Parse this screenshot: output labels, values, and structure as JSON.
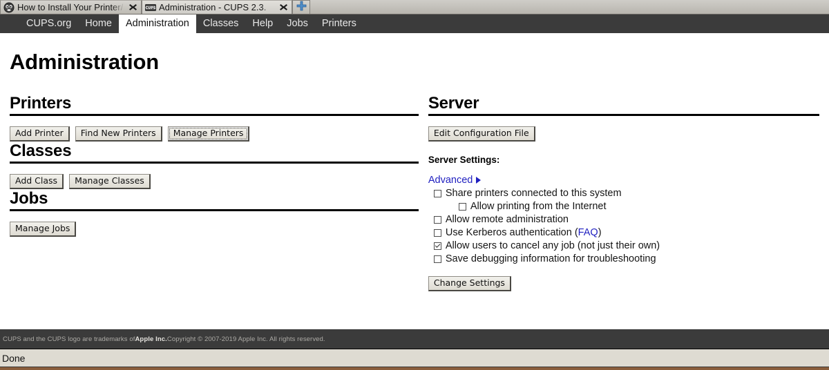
{
  "browser": {
    "tabs": [
      {
        "title": "How to Install Your Printer/",
        "favicon": "printer-tab-icon",
        "active": false,
        "close_label": "✖"
      },
      {
        "title": "Administration - CUPS 2.3.",
        "favicon": "cups-favicon",
        "active": true,
        "close_label": "✖"
      }
    ],
    "new_tab_label": "+"
  },
  "navbar": {
    "items": [
      {
        "label": "CUPS.org",
        "current": false
      },
      {
        "label": "Home",
        "current": false
      },
      {
        "label": "Administration",
        "current": true
      },
      {
        "label": "Classes",
        "current": false
      },
      {
        "label": "Help",
        "current": false
      },
      {
        "label": "Jobs",
        "current": false
      },
      {
        "label": "Printers",
        "current": false
      }
    ]
  },
  "page": {
    "title": "Administration"
  },
  "printers": {
    "heading": "Printers",
    "buttons": [
      {
        "label": "Add Printer",
        "focused": false
      },
      {
        "label": "Find New Printers",
        "focused": false
      },
      {
        "label": "Manage Printers",
        "focused": true
      }
    ]
  },
  "classes": {
    "heading": "Classes",
    "buttons": [
      {
        "label": "Add Class",
        "focused": false
      },
      {
        "label": "Manage Classes",
        "focused": false
      }
    ]
  },
  "jobs": {
    "heading": "Jobs",
    "buttons": [
      {
        "label": "Manage Jobs",
        "focused": false
      }
    ]
  },
  "server": {
    "heading": "Server",
    "edit_config_label": "Edit Configuration File",
    "settings_label": "Server Settings:",
    "advanced_label": "Advanced",
    "advanced_marker": "triangle-right-icon",
    "options": [
      {
        "label": "Share printers connected to this system",
        "checked": false,
        "indent": false
      },
      {
        "label": "Allow printing from the Internet",
        "checked": false,
        "indent": true
      },
      {
        "label": "Allow remote administration",
        "checked": false,
        "indent": false
      },
      {
        "label": "Use Kerberos authentication (",
        "checked": false,
        "indent": false,
        "link_text": "FAQ",
        "label_tail": ")"
      },
      {
        "label": "Allow users to cancel any job (not just their own)",
        "checked": true,
        "indent": false
      },
      {
        "label": "Save debugging information for troubleshooting",
        "checked": false,
        "indent": false
      }
    ],
    "change_settings_label": "Change Settings"
  },
  "footer": {
    "text_before": "CUPS and the CUPS logo are trademarks of ",
    "bold": "Apple Inc.",
    "text_after": " Copyright © 2007-2019 Apple Inc. All rights reserved."
  },
  "status": {
    "text": "Done"
  },
  "colors": {
    "navbar_bg": "#3b3b3b",
    "link": "#2020c0",
    "status_bg": "#dedbd2",
    "bottom_bar": "#8a5e3c"
  }
}
